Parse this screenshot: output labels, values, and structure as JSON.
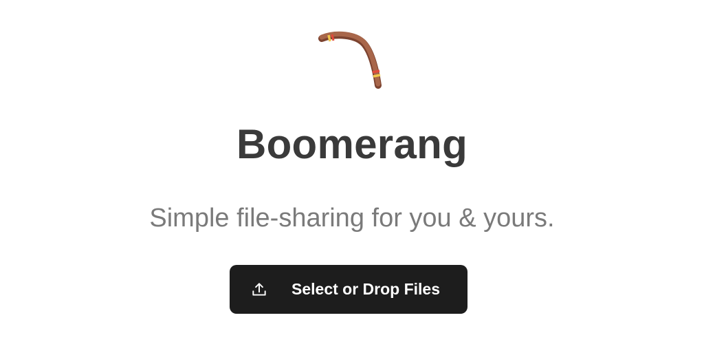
{
  "app": {
    "title": "Boomerang",
    "tagline": "Simple file-sharing for you & yours."
  },
  "logo": {
    "icon": "boomerang-icon",
    "colors": {
      "wood": "#9a5a3d",
      "wood_dark": "#7c4330",
      "band_yellow": "#f2c94c",
      "band_red": "#e24a3b"
    }
  },
  "upload": {
    "label": "Select or Drop Files",
    "icon": "upload-icon",
    "background": "#1d1d1d",
    "text_color": "#ffffff"
  }
}
